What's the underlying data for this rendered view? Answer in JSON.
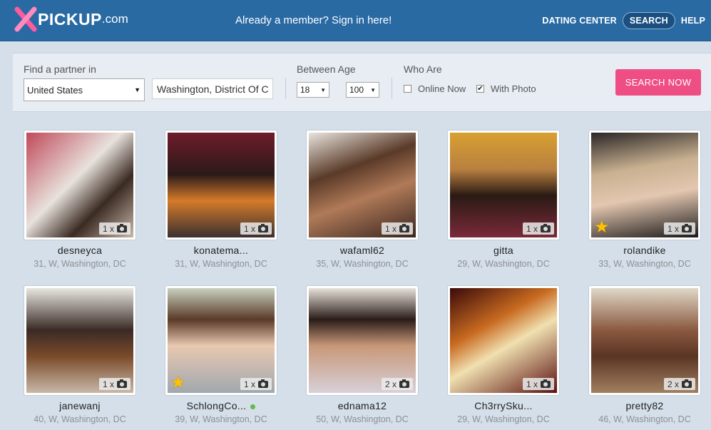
{
  "header": {
    "logo_brand": "PICKUP",
    "logo_domain": ".com",
    "signin_text": "Already a member? Sign in here!",
    "nav": {
      "dating_center": "DATING CENTER",
      "search": "SEARCH",
      "help": "HELP"
    }
  },
  "search": {
    "find_label": "Find a partner in",
    "country_value": "United States",
    "city_value": "Washington, District Of C",
    "age_label": "Between Age",
    "age_min": "18",
    "age_max": "100",
    "who_label": "Who Are",
    "online_now_label": "Online Now",
    "online_now_checked": false,
    "with_photo_label": "With Photo",
    "with_photo_checked": true,
    "button_label": "SEARCH NOW"
  },
  "profiles": [
    {
      "username": "desneyca",
      "info": "31, W, Washington, DC",
      "photos": "1 x",
      "star": false,
      "online": false,
      "bg": "linear-gradient(135deg,#c04a5a 0%,#e8e2dc 45%,#3a2a22 70%,#c9b8a8 100%)"
    },
    {
      "username": "konatema...",
      "info": "31, W, Washington, DC",
      "photos": "1 x",
      "star": false,
      "online": false,
      "bg": "linear-gradient(180deg,#6e1c2a 0%,#2a1a1a 40%,#d57b2a 65%,#3a3030 100%)"
    },
    {
      "username": "wafaml62",
      "info": "35, W, Washington, DC",
      "photos": "1 x",
      "star": false,
      "online": false,
      "bg": "linear-gradient(160deg,#e8e4de 0%,#5a3a28 35%,#b07a58 60%,#3a2620 100%)"
    },
    {
      "username": "gitta",
      "info": "29, W, Washington, DC",
      "photos": "1 x",
      "star": false,
      "online": false,
      "bg": "linear-gradient(180deg,#d8a030 0%,#b88040 35%,#2a1a14 60%,#7a2a3a 100%)"
    },
    {
      "username": "rolandike",
      "info": "33, W, Washington, DC",
      "photos": "1 x",
      "star": true,
      "online": false,
      "bg": "linear-gradient(170deg,#2a2626 0%,#c8b090 35%,#e3c7b0 60%,#1c1a1a 100%)"
    },
    {
      "username": "janewanj",
      "info": "40, W, Washington, DC",
      "photos": "1 x",
      "star": false,
      "online": false,
      "bg": "linear-gradient(180deg,#e8e6e0 0%,#3a2a26 40%,#7a4a2a 65%,#c8b8a8 100%)"
    },
    {
      "username": "SchlongCo...",
      "info": "39, W, Washington, DC",
      "photos": "1 x",
      "star": true,
      "online": true,
      "bg": "linear-gradient(180deg,#c8d0c0 0%,#5a3a28 30%,#e8c8b0 55%,#a0a8b0 100%)"
    },
    {
      "username": "ednama12",
      "info": "50, W, Washington, DC",
      "photos": "2 x",
      "star": false,
      "online": false,
      "bg": "linear-gradient(180deg,#e8e2da 0%,#2a1c18 30%,#c89878 55%,#d8d0d8 100%)"
    },
    {
      "username": "Ch3rrySku...",
      "info": "29, W, Washington, DC",
      "photos": "1 x",
      "star": false,
      "online": false,
      "bg": "linear-gradient(150deg,#3a0a0a 0%,#c86a20 35%,#f0e0b0 55%,#5a1010 100%)"
    },
    {
      "username": "pretty82",
      "info": "46, W, Washington, DC",
      "photos": "2 x",
      "star": false,
      "online": false,
      "bg": "linear-gradient(180deg,#e0d8c8 0%,#8a5a40 40%,#5a3424 65%,#a08060 100%)"
    }
  ],
  "colors": {
    "header_bg": "#2a6aa3",
    "accent_pink": "#ee4e84",
    "page_bg": "#d5dfe9"
  }
}
